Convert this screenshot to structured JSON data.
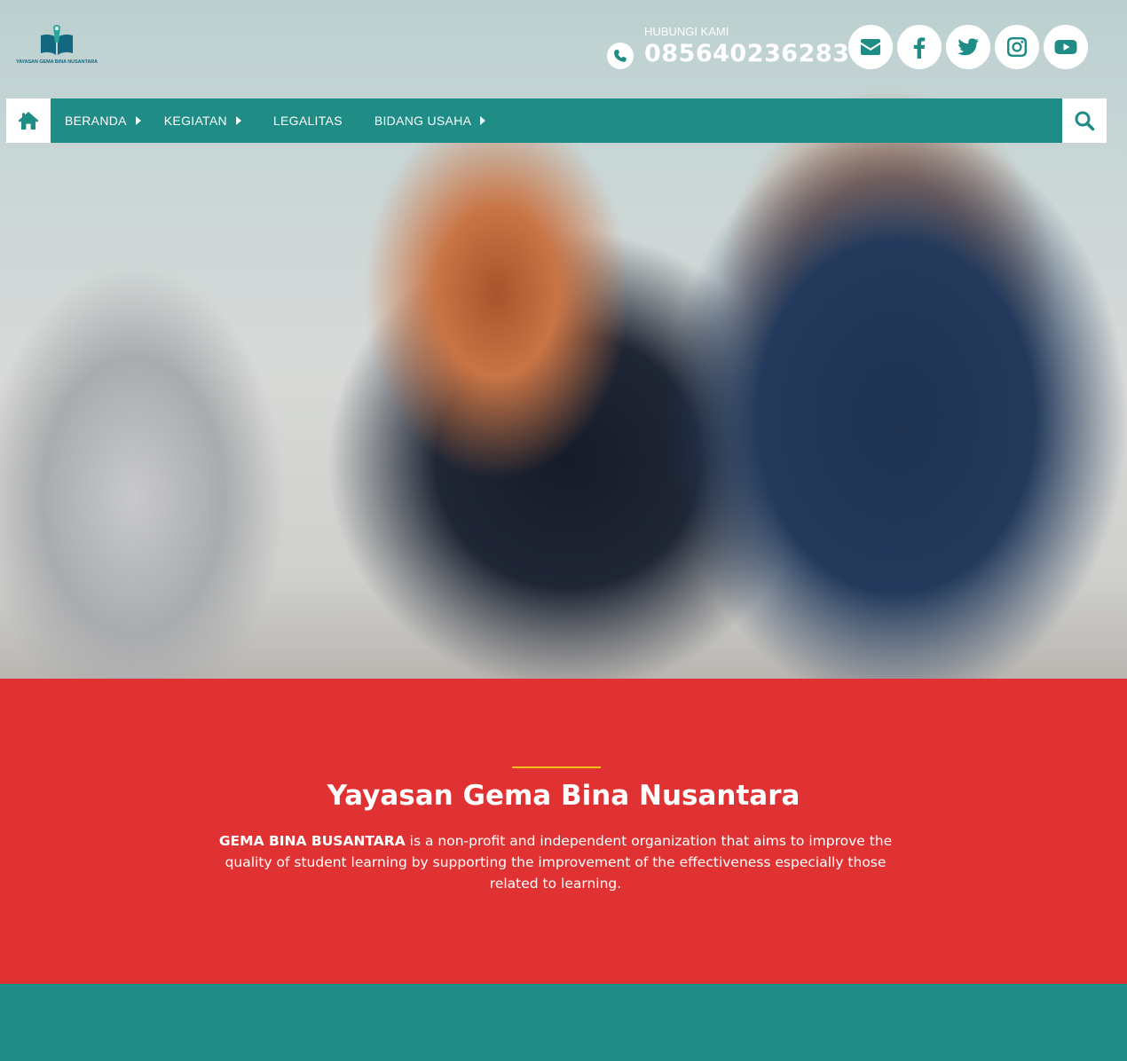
{
  "header": {
    "logo_text": "YAYASAN GEMA BINA NUSANTARA",
    "contact_label": "HUBUNGI KAMI",
    "phone_number": "085640236283"
  },
  "socials": [
    {
      "icon": "envelope-icon"
    },
    {
      "icon": "facebook-icon"
    },
    {
      "icon": "twitter-icon"
    },
    {
      "icon": "instagram-icon"
    },
    {
      "icon": "youtube-icon"
    }
  ],
  "nav": {
    "items": [
      {
        "label": "BERANDA",
        "has_submenu": true
      },
      {
        "label": "KEGIATAN",
        "has_submenu": true
      },
      {
        "label": "LEGALITAS",
        "has_submenu": false
      },
      {
        "label": "BIDANG USAHA",
        "has_submenu": true
      }
    ]
  },
  "about": {
    "title": "Yayasan Gema Bina Nusantara",
    "org_name": "GEMA BINA BUSANTARA",
    "description": " is a non-profit and independent organization that aims to improve the quality of student learning by supporting the improvement of the effectiveness especially those related to learning."
  },
  "colors": {
    "primary": "#1f8c86",
    "accent_red": "#e03232",
    "divider_yellow": "#f2c21b",
    "logo_blue": "#13677f"
  }
}
